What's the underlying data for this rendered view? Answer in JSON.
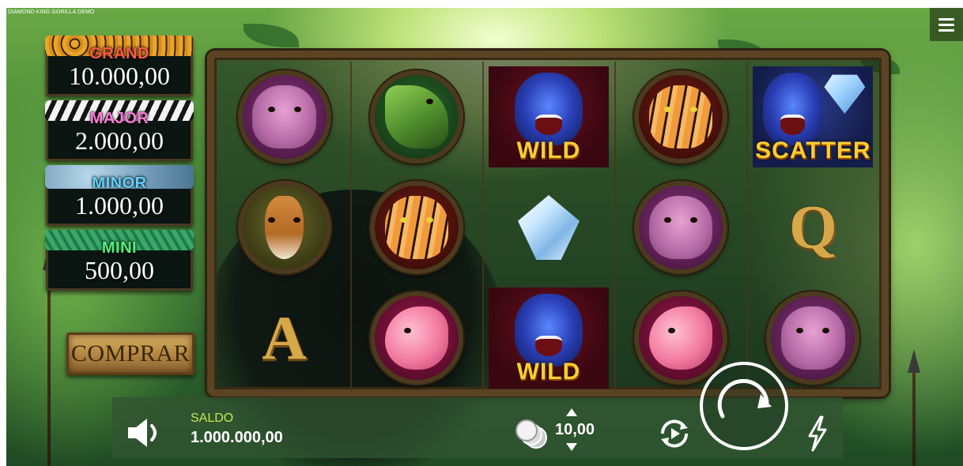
{
  "window": {
    "title": "DIAMOND KING GORILLA DEMO"
  },
  "jackpots": [
    {
      "name": "GRAND",
      "value": "10.000,00"
    },
    {
      "name": "MAJOR",
      "value": "2.000,00"
    },
    {
      "name": "MINOR",
      "value": "1.000,00"
    },
    {
      "name": "MINI",
      "value": "500,00"
    }
  ],
  "buy_button": {
    "label": "COMPRAR"
  },
  "reels": {
    "labels": {
      "wild": "WILD",
      "scatter": "SCATTER",
      "q": "Q",
      "a": "A"
    },
    "grid": [
      [
        "hippo",
        "croc",
        "wild-gorilla",
        "tiger",
        "scatter-gorilla-diamond"
      ],
      [
        "antelope",
        "tiger",
        "diamond",
        "hippo",
        "letter-q"
      ],
      [
        "letter-a",
        "flamingo",
        "wild-gorilla",
        "flamingo",
        "hippo"
      ]
    ]
  },
  "bottom_bar": {
    "balance_label": "SALDO",
    "balance_value": "1.000.000,00",
    "bet_value": "10,00"
  },
  "icons": {
    "menu": "menu-icon",
    "sound": "speaker-icon",
    "coins": "coins-icon",
    "bet_up": "chevron-up-icon",
    "bet_down": "chevron-down-icon",
    "autoplay": "autoplay-icon",
    "spin": "spin-icon",
    "turbo": "lightning-icon"
  },
  "colors": {
    "balance_label": "#c8e84a",
    "wild_text": "#ffcc33",
    "grand": "#ff5a4a",
    "major": "#ff7ad9",
    "minor": "#5fd2ff",
    "mini": "#53f07a"
  }
}
